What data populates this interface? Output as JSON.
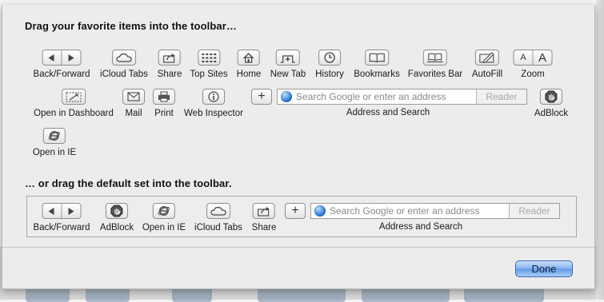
{
  "sheet": {
    "heading_favorites": "Drag your favorite items into the toolbar…",
    "heading_default": "… or drag the default set into the toolbar.",
    "done_label": "Done"
  },
  "favorites": [
    {
      "label": "Back/Forward",
      "icon": "back-forward-icon"
    },
    {
      "label": "iCloud Tabs",
      "icon": "cloud-icon"
    },
    {
      "label": "Share",
      "icon": "share-icon"
    },
    {
      "label": "Top Sites",
      "icon": "grid-icon"
    },
    {
      "label": "Home",
      "icon": "home-icon"
    },
    {
      "label": "New Tab",
      "icon": "new-tab-icon"
    },
    {
      "label": "History",
      "icon": "clock-icon"
    },
    {
      "label": "Bookmarks",
      "icon": "book-icon"
    },
    {
      "label": "Favorites Bar",
      "icon": "favorites-bar-icon"
    },
    {
      "label": "AutoFill",
      "icon": "pencil-icon"
    },
    {
      "label": "Zoom",
      "icon": "zoom-icon",
      "small": "A",
      "large": "A"
    },
    {
      "label": "Open in Dashboard",
      "icon": "dashboard-icon"
    },
    {
      "label": "Mail",
      "icon": "mail-icon"
    },
    {
      "label": "Print",
      "icon": "print-icon"
    },
    {
      "label": "Web Inspector",
      "icon": "info-icon"
    },
    {
      "label": "AdBlock",
      "icon": "adblock-hand-icon"
    },
    {
      "label": "Open in IE",
      "icon": "ie-icon"
    }
  ],
  "address_bar": {
    "plus": "+",
    "placeholder": "Search Google or enter an address",
    "reader": "Reader",
    "label": "Address and Search"
  },
  "default_set": [
    {
      "label": "Back/Forward",
      "icon": "back-forward-icon"
    },
    {
      "label": "AdBlock",
      "icon": "adblock-hand-icon"
    },
    {
      "label": "Open in IE",
      "icon": "ie-icon"
    },
    {
      "label": "iCloud Tabs",
      "icon": "cloud-icon"
    },
    {
      "label": "Share",
      "icon": "share-icon"
    }
  ]
}
